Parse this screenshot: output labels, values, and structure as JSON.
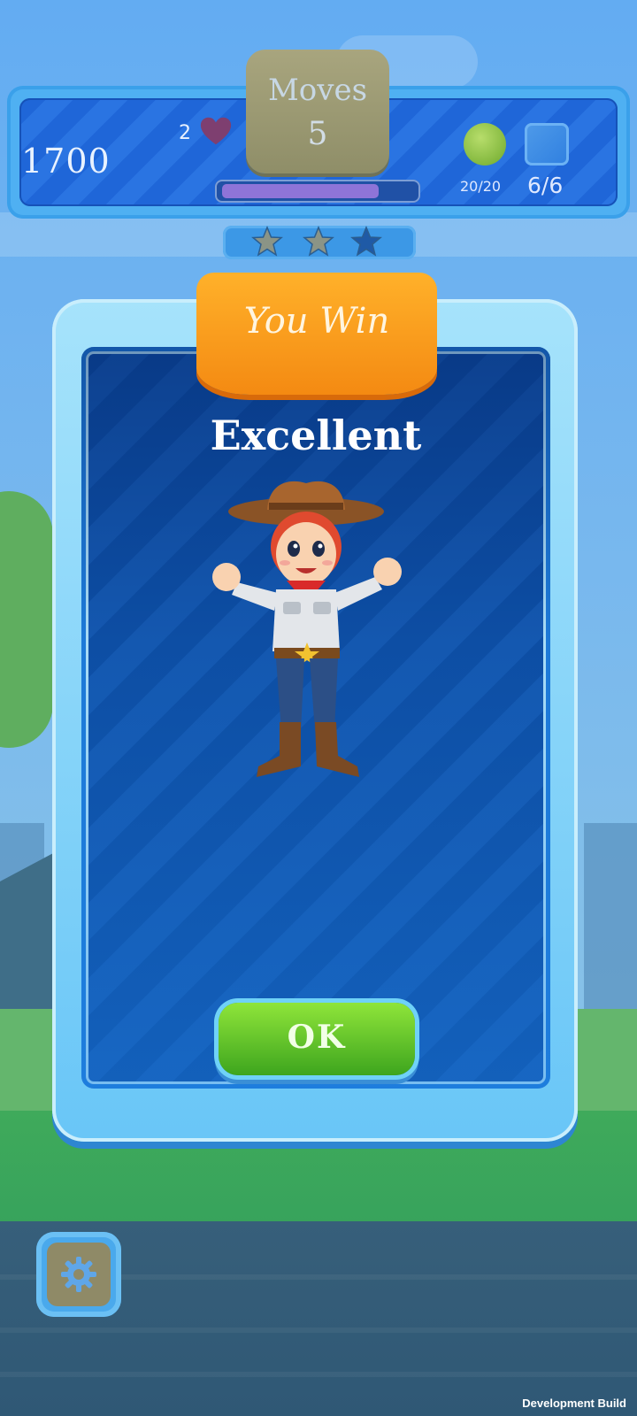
{
  "hud": {
    "score": "1700",
    "lives": "2",
    "moves_label": "Moves",
    "moves_value": "5",
    "level_progress": 0.82,
    "lime_goal": "20/20",
    "ice_goal": "6/6"
  },
  "stars": {
    "earned": 2,
    "total": 3,
    "earned_color": "#8b9486",
    "unearned_color": "#1f5aa6"
  },
  "win_dialog": {
    "title": "You Win",
    "rating": "Excellent",
    "ok_label": "OK"
  },
  "footer": {
    "build_label": "Development Build"
  },
  "colors": {
    "panel_blue": "#1458b0",
    "ribbon_orange": "#f48a12",
    "ok_green": "#5fc227"
  },
  "icons": [
    "heart-icon",
    "lime-goal-icon",
    "ice-tile-goal-icon",
    "star-icon",
    "gear-icon",
    "cowboy-mascot"
  ]
}
